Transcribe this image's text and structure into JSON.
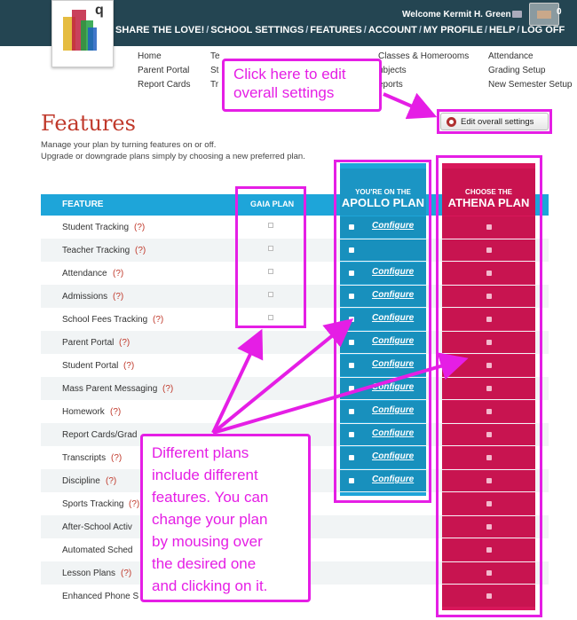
{
  "header": {
    "welcome": "Welcome Kermit H. Green",
    "notification_count": "0",
    "nav": [
      "SHARE THE LOVE!",
      "SCHOOL SETTINGS",
      "FEATURES",
      "ACCOUNT",
      "MY PROFILE",
      "HELP",
      "LOG OFF"
    ]
  },
  "submenu": {
    "col1": [
      "Home",
      "Parent Portal",
      "Report Cards"
    ],
    "col2": [
      "Te",
      "St",
      "Tr"
    ],
    "col3": [
      "Classes & Homerooms",
      "ubjects",
      "eports"
    ],
    "col4": [
      "Attendance",
      "Grading Setup",
      "New Semester Setup"
    ]
  },
  "page": {
    "title": "Features",
    "desc_line1": "Manage your plan by turning features on or off.",
    "desc_line2": "Upgrade or downgrade plans simply by choosing a new preferred plan.",
    "edit_button": "Edit overall settings"
  },
  "table": {
    "col_feature": "FEATURE",
    "col_gaia": "GAIA PLAN",
    "apollo_small": "YOU'RE ON THE",
    "apollo_big": "APOLLO PLAN",
    "athena_small": "CHOOSE THE",
    "athena_big": "ATHENA PLAN",
    "configure": "Configure",
    "help_mark": "(?)",
    "rows": [
      {
        "label": "Student Tracking",
        "help": true
      },
      {
        "label": "Teacher Tracking",
        "help": true
      },
      {
        "label": "Attendance",
        "help": true
      },
      {
        "label": "Admissions",
        "help": true
      },
      {
        "label": "School Fees Tracking",
        "help": true
      },
      {
        "label": "Parent Portal",
        "help": true
      },
      {
        "label": "Student Portal",
        "help": true
      },
      {
        "label": "Mass Parent Messaging",
        "help": true
      },
      {
        "label": "Homework",
        "help": true
      },
      {
        "label": "Report Cards/Grad",
        "help": false
      },
      {
        "label": "Transcripts",
        "help": true
      },
      {
        "label": "Discipline",
        "help": true
      },
      {
        "label": "Sports Tracking",
        "help": true
      },
      {
        "label": "After-School Activ",
        "help": false
      },
      {
        "label": "Automated Sched",
        "help": false
      },
      {
        "label": "Lesson Plans",
        "help": true
      },
      {
        "label": "Enhanced Phone S",
        "help": false
      }
    ]
  },
  "callouts": {
    "top": [
      "Click here to edit",
      "overall settings"
    ],
    "bottom": [
      "Different plans",
      "include different",
      "features. You can",
      "change your plan",
      "by mousing over",
      "the desired one",
      "and clicking on it."
    ]
  },
  "colors": {
    "topbar": "#244552",
    "apollo": "#1ea5d9",
    "athena": "#d8175a",
    "annotation": "#e51ee5",
    "title": "#c0392b"
  }
}
